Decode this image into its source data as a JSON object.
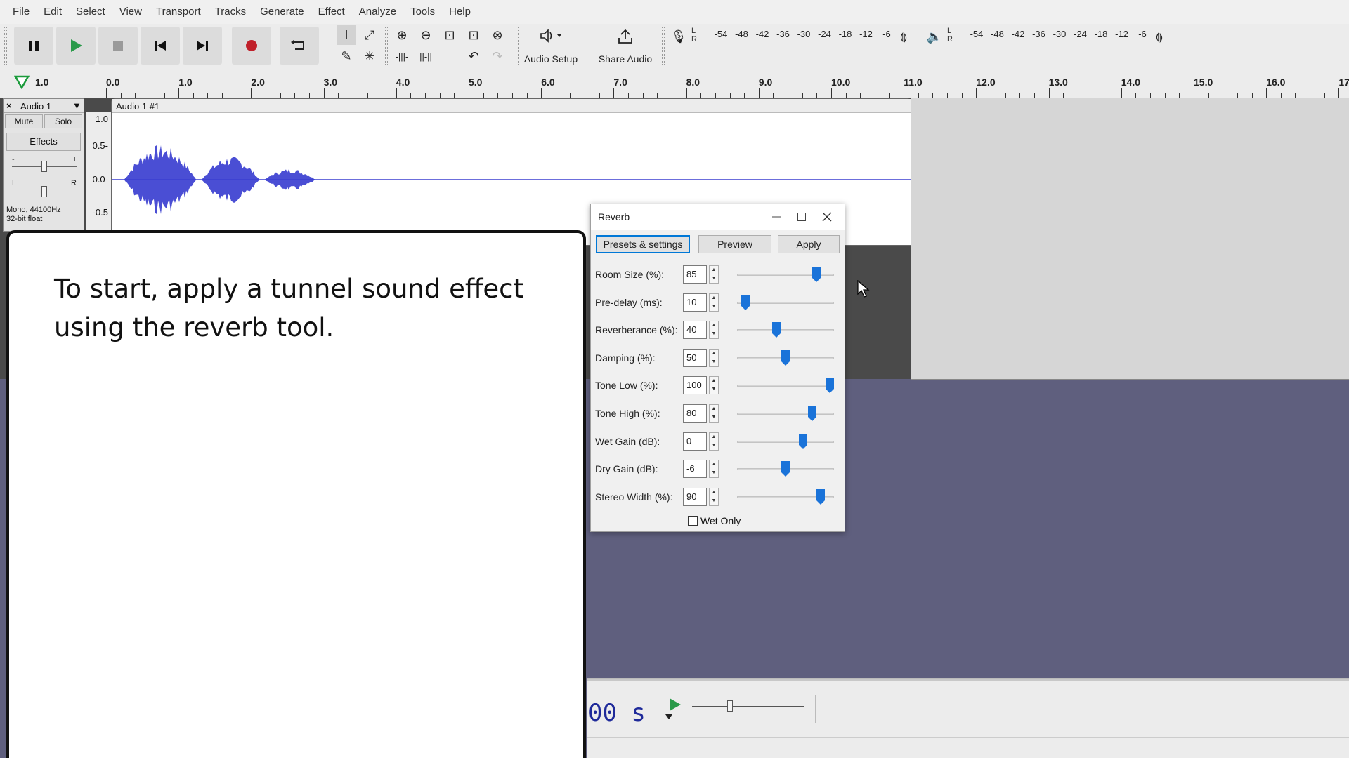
{
  "menubar": {
    "items": [
      "File",
      "Edit",
      "Select",
      "View",
      "Transport",
      "Tracks",
      "Generate",
      "Effect",
      "Analyze",
      "Tools",
      "Help"
    ]
  },
  "toolbar": {
    "audio_setup_label": "Audio Setup",
    "share_audio_label": "Share Audio",
    "record_meter_ticks": [
      "-54",
      "-48",
      "-42",
      "-36",
      "-30",
      "-24",
      "-18",
      "-12",
      "-6"
    ],
    "play_meter_ticks": [
      "-54",
      "-48",
      "-42",
      "-36",
      "-30",
      "-24",
      "-18",
      "-12",
      "-6"
    ],
    "meter_left": "L",
    "meter_right": "R",
    "colors": {
      "play": "#2a9a4a",
      "record": "#c0202a",
      "button_bg": "#dcdcdc"
    }
  },
  "ruler": {
    "start_label": "1.0",
    "ticks": [
      "0.0",
      "1.0",
      "2.0",
      "3.0",
      "4.0",
      "5.0",
      "6.0",
      "7.0",
      "8.0",
      "9.0",
      "10.0",
      "11.0",
      "12.0",
      "13.0",
      "14.0",
      "15.0",
      "16.0",
      "17."
    ]
  },
  "track": {
    "name": "Audio 1",
    "mute_label": "Mute",
    "solo_label": "Solo",
    "effects_label": "Effects",
    "gain_minus": "-",
    "gain_plus": "+",
    "pan_left": "L",
    "pan_right": "R",
    "format_line1": "Mono, 44100Hz",
    "format_line2": "32-bit float",
    "clip_name": "Audio 1 #1",
    "vruler": [
      "1.0",
      "0.5-",
      "0.0-",
      "-0.5"
    ],
    "waveform_color": "#3b3fd0"
  },
  "instruction": {
    "text": "To start, apply a  tunnel sound effect using the reverb tool."
  },
  "reverb_dialog": {
    "title": "Reverb",
    "buttons": {
      "presets": "Presets & settings",
      "preview": "Preview",
      "apply": "Apply"
    },
    "params": [
      {
        "label": "Room Size (%):",
        "value": "85",
        "fraction": 0.85
      },
      {
        "label": "Pre-delay (ms):",
        "value": "10",
        "fraction": 0.05
      },
      {
        "label": "Reverberance (%):",
        "value": "40",
        "fraction": 0.4
      },
      {
        "label": "Damping (%):",
        "value": "50",
        "fraction": 0.5
      },
      {
        "label": "Tone Low (%):",
        "value": "100",
        "fraction": 1.0
      },
      {
        "label": "Tone High (%):",
        "value": "80",
        "fraction": 0.8
      },
      {
        "label": "Wet Gain (dB):",
        "value": "0",
        "fraction": 0.7
      },
      {
        "label": "Dry Gain (dB):",
        "value": "-6",
        "fraction": 0.5
      },
      {
        "label": "Stereo Width (%):",
        "value": "90",
        "fraction": 0.9
      }
    ],
    "wet_only_label": "Wet Only",
    "thumb_color": "#1a73d9"
  },
  "bottom": {
    "time_display": "00 s"
  }
}
